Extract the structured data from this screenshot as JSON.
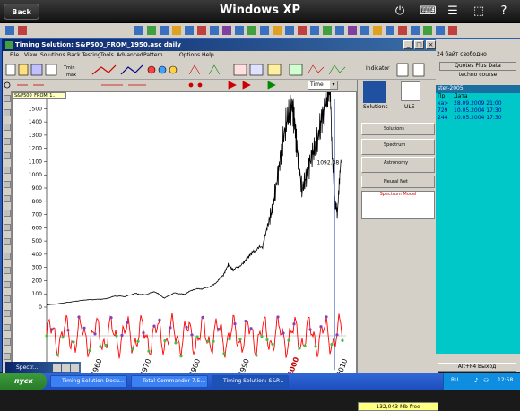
{
  "remote": {
    "back_label": "Back",
    "title": "Windows XP"
  },
  "window": {
    "title": "Timing Solution:  S&P500_FROM_1950.asc  daily",
    "menus": [
      "File",
      "View",
      "Solutions",
      "Back Testing",
      "Tools",
      "Advanced",
      "Pattern",
      "Options",
      "Help"
    ],
    "indicator_label": "Indicator",
    "time_select": "Time",
    "chart_tab": "S&P500_FROM_1..."
  },
  "chart_data": {
    "type": "line",
    "yticks": [
      1500,
      1400,
      1300,
      1200,
      1100,
      1000,
      900,
      800,
      700,
      600,
      500,
      400,
      300,
      200,
      100,
      0
    ],
    "ylim": [
      0,
      1570
    ],
    "xticks": [
      "1960",
      "1970",
      "1980",
      "1990",
      "2000",
      "2010"
    ],
    "highlight_tick": "2000",
    "price_label": "1092.38",
    "series": [
      {
        "x": [
          1950,
          1952,
          1954,
          1956,
          1958,
          1960,
          1962,
          1964,
          1966,
          1968,
          1970,
          1972,
          1974,
          1976,
          1978,
          1980,
          1982,
          1984,
          1986,
          1987,
          1988,
          1990,
          1991,
          1992,
          1994,
          1995,
          1996,
          1997,
          1998,
          1999,
          2000,
          2000.5,
          2001,
          2002,
          2003,
          2004,
          2005,
          2006,
          2007,
          2007.8,
          2008.5,
          2009.2,
          2010
        ],
        "values": [
          17,
          24,
          35,
          45,
          55,
          58,
          62,
          84,
          80,
          103,
          92,
          118,
          68,
          107,
          96,
          135,
          140,
          167,
          242,
          320,
          280,
          330,
          375,
          420,
          460,
          615,
          740,
          970,
          1230,
          1420,
          1520,
          1420,
          1200,
          880,
          1000,
          1150,
          1220,
          1420,
          1560,
          1540,
          900,
          680,
          1092
        ]
      }
    ]
  },
  "right_panel": {
    "solutions": "Solutions",
    "ule": "ULE",
    "solutions_btn": "Solutions",
    "spectrum": "Spectrum",
    "astronomy": "Astronomy",
    "neural_net": "Neural Net",
    "spectrum_model": "Spectrum Model",
    "free_space": "132,043 Mb free"
  },
  "side_window": {
    "free_text": "24 байт свободно",
    "title": "Quotes Plus Data",
    "subtitle": "techno course",
    "list_header": "ster-2005",
    "col_name": "Пр",
    "col_date": "Дата",
    "rows": [
      {
        "name": "ка>",
        "date": "28.09.2009 21:00"
      },
      {
        "name": "729",
        "date": "10.05.2004 17:30"
      },
      {
        "name": "244",
        "date": "10.05.2004 17:30"
      }
    ],
    "alt_btn": "Alt+F4 Выход"
  },
  "spectr_window": {
    "title": "Spectr..."
  },
  "taskbar": {
    "start": "пуск",
    "tasks": [
      "Timing Solution Docu...",
      "Total Commander 7.5...",
      "Timing Solution: S&P..."
    ],
    "lang": "RU",
    "clock": "12:58"
  }
}
